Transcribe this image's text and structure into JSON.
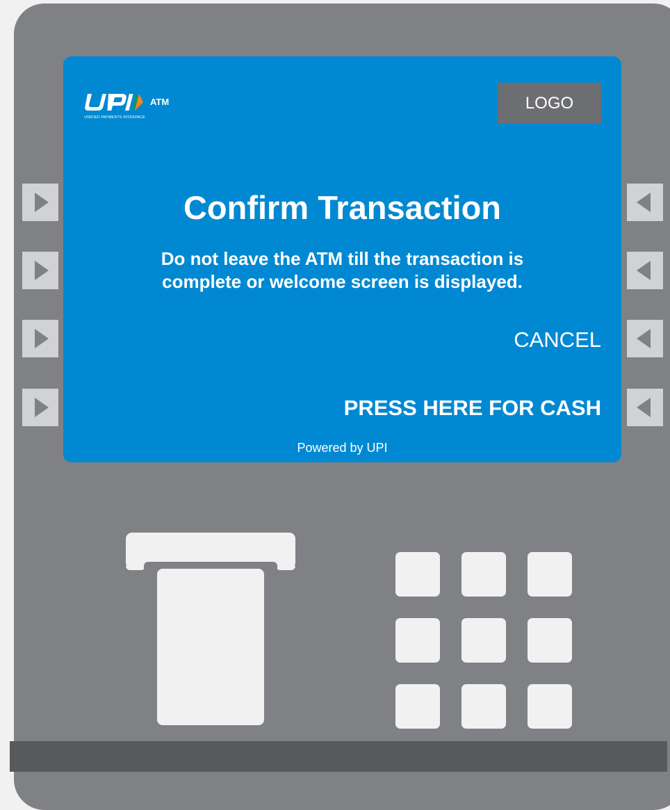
{
  "screen": {
    "brand": {
      "logo_text": "UPI",
      "tagline": "UNIFIED PAYMENTS INTERFACE",
      "product": "ATM"
    },
    "bank_logo_placeholder": "LOGO",
    "title": "Confirm Transaction",
    "message_line1": "Do not leave the ATM till the transaction is",
    "message_line2": "complete or welcome screen is displayed.",
    "options": {
      "cancel": "CANCEL",
      "cash": "PRESS HERE FOR CASH"
    },
    "footer": "Powered by UPI"
  },
  "colors": {
    "screen_background": "#0089d2",
    "atm_body": "#808184",
    "logo_placeholder": "#6d6e71",
    "side_key": "#d1d2d4",
    "side_key_arrow": "#808184",
    "bottom_bar": "#58595b",
    "upi_orange": "#f58220",
    "upi_green": "#0a9a48"
  },
  "icons": {
    "left_keys": "triangle-right-icon",
    "right_keys": "triangle-left-icon"
  }
}
